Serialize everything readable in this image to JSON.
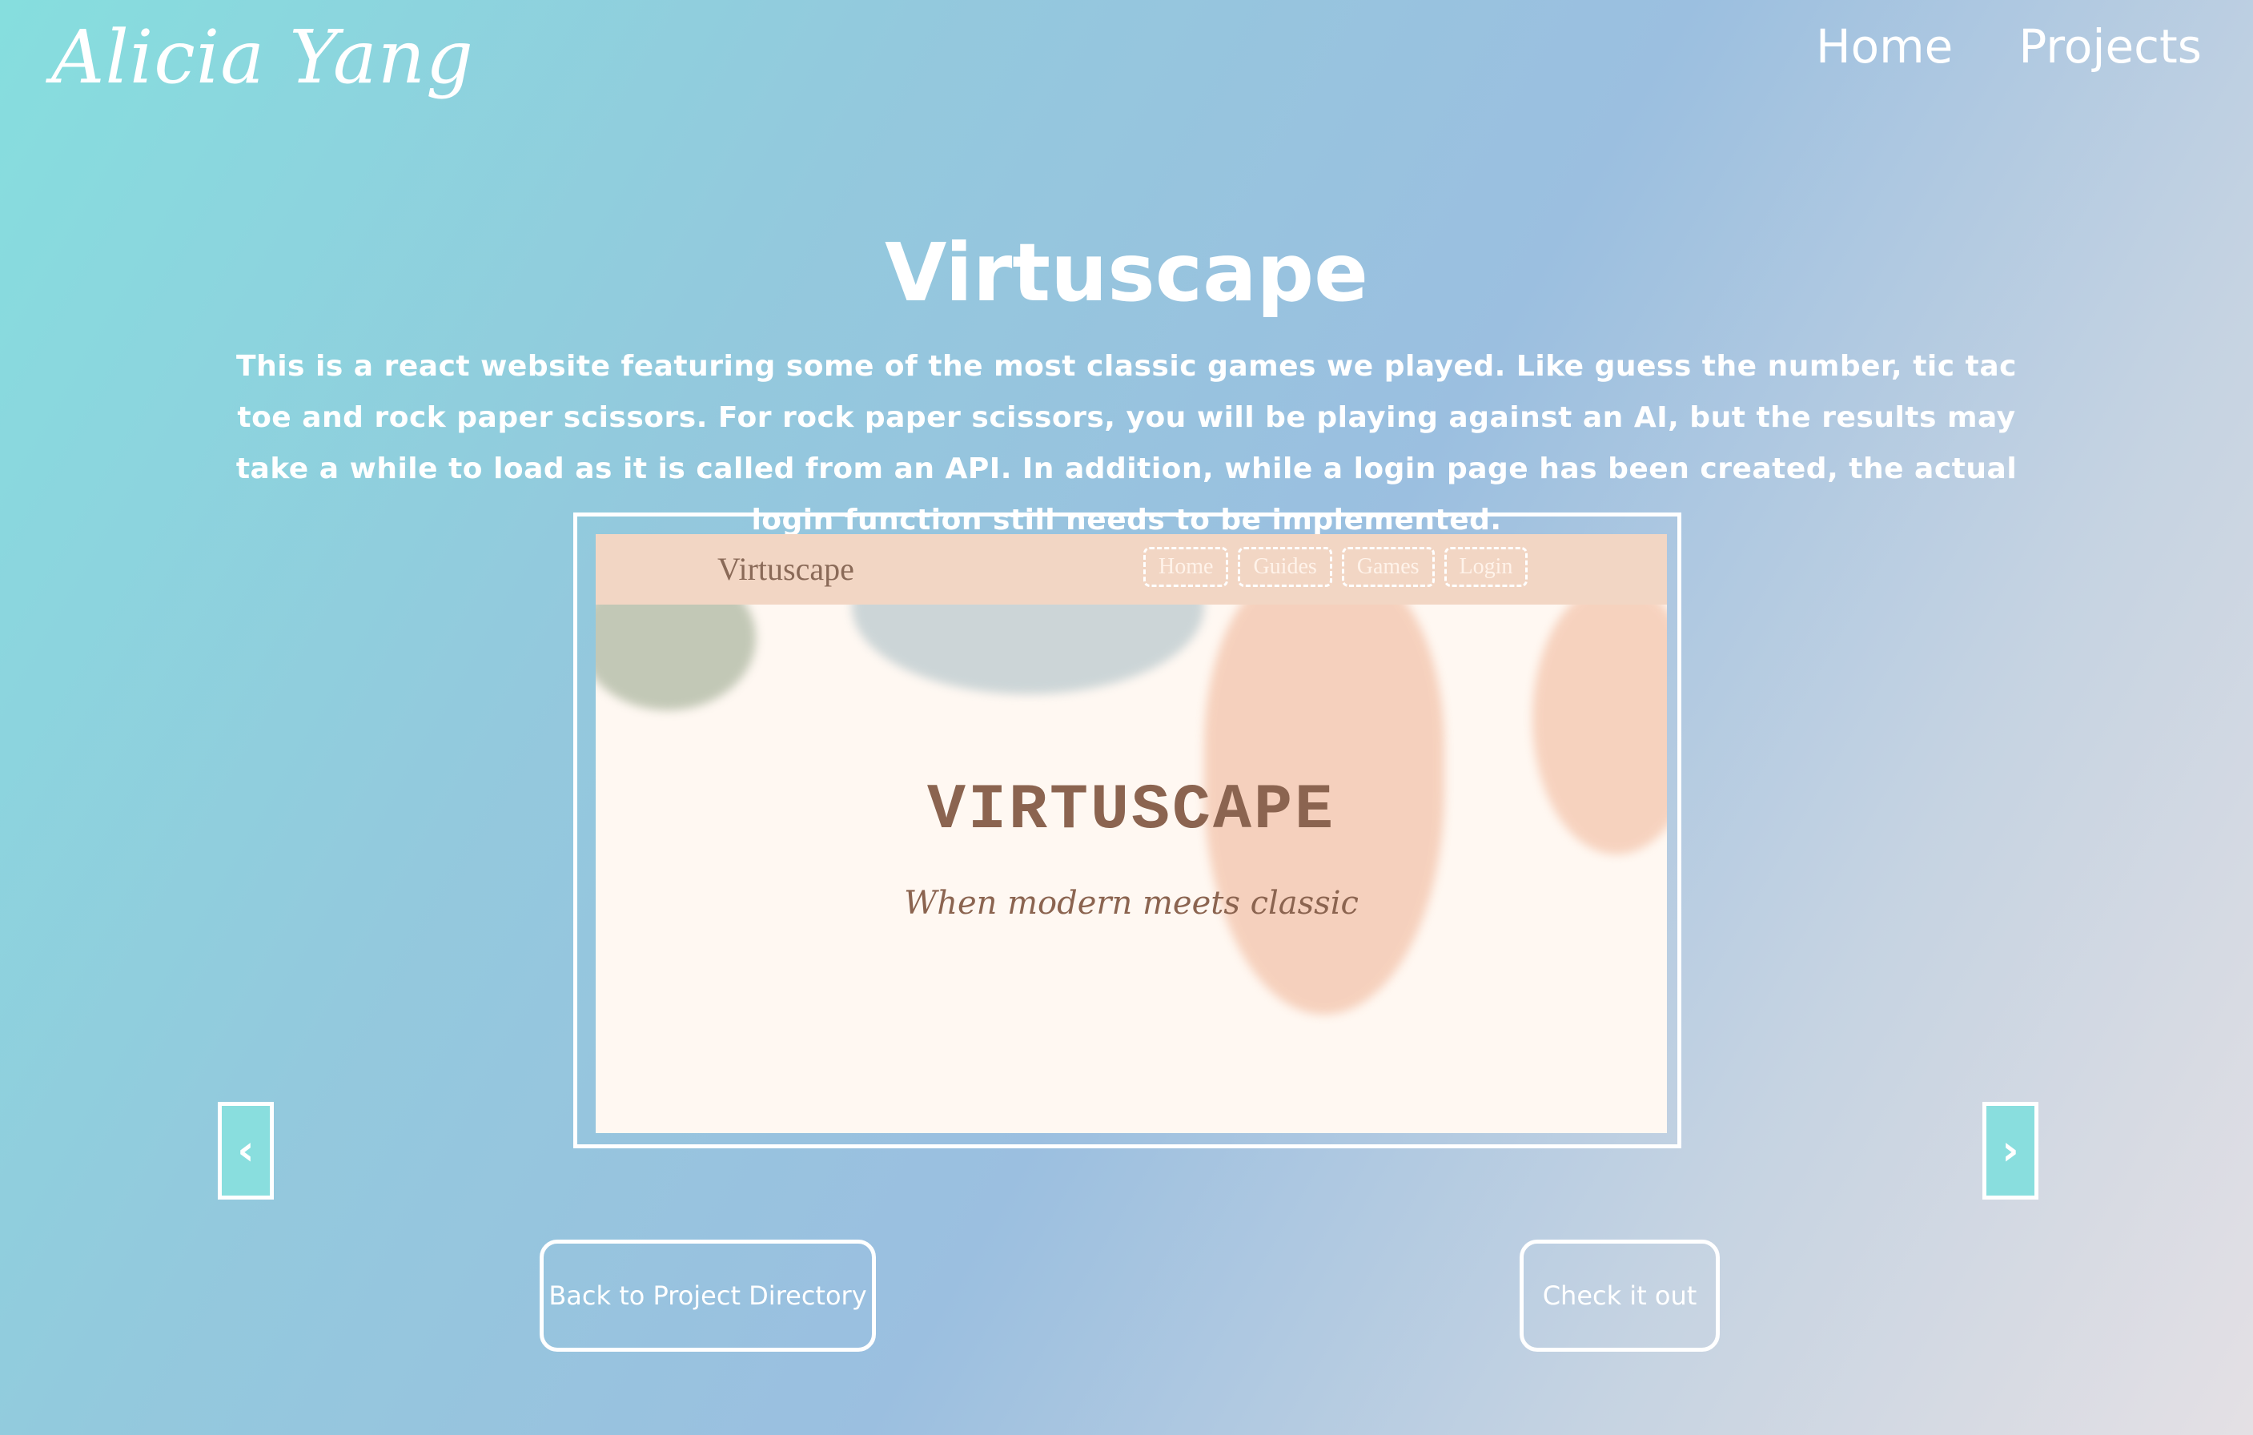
{
  "header": {
    "logo": "Alicia Yang",
    "nav": [
      "Home",
      "Projects"
    ]
  },
  "project": {
    "title": "Virtuscape",
    "description": "This is a react website featuring some of the most classic games we played. Like guess the number, tic tac toe and rock paper scissors. For rock paper scissors, you will be playing against an AI, but the results may take a while to load as it is called from an API. In addition, while a login page has been created, the actual login function still needs to be implemented."
  },
  "preview": {
    "brand": "Virtuscape",
    "links": [
      "Home",
      "Guides",
      "Games",
      "Login"
    ],
    "hero_title": "VIRTUSCAPE",
    "hero_subtitle": "When modern meets classic"
  },
  "carousel": {
    "prev": "‹",
    "next": "›"
  },
  "actions": {
    "back": "Back to Project Directory",
    "check": "Check it out"
  },
  "colors": {
    "accent": "#89dede",
    "preview_nav": "#f2d6c4",
    "preview_text": "#8b6450"
  }
}
